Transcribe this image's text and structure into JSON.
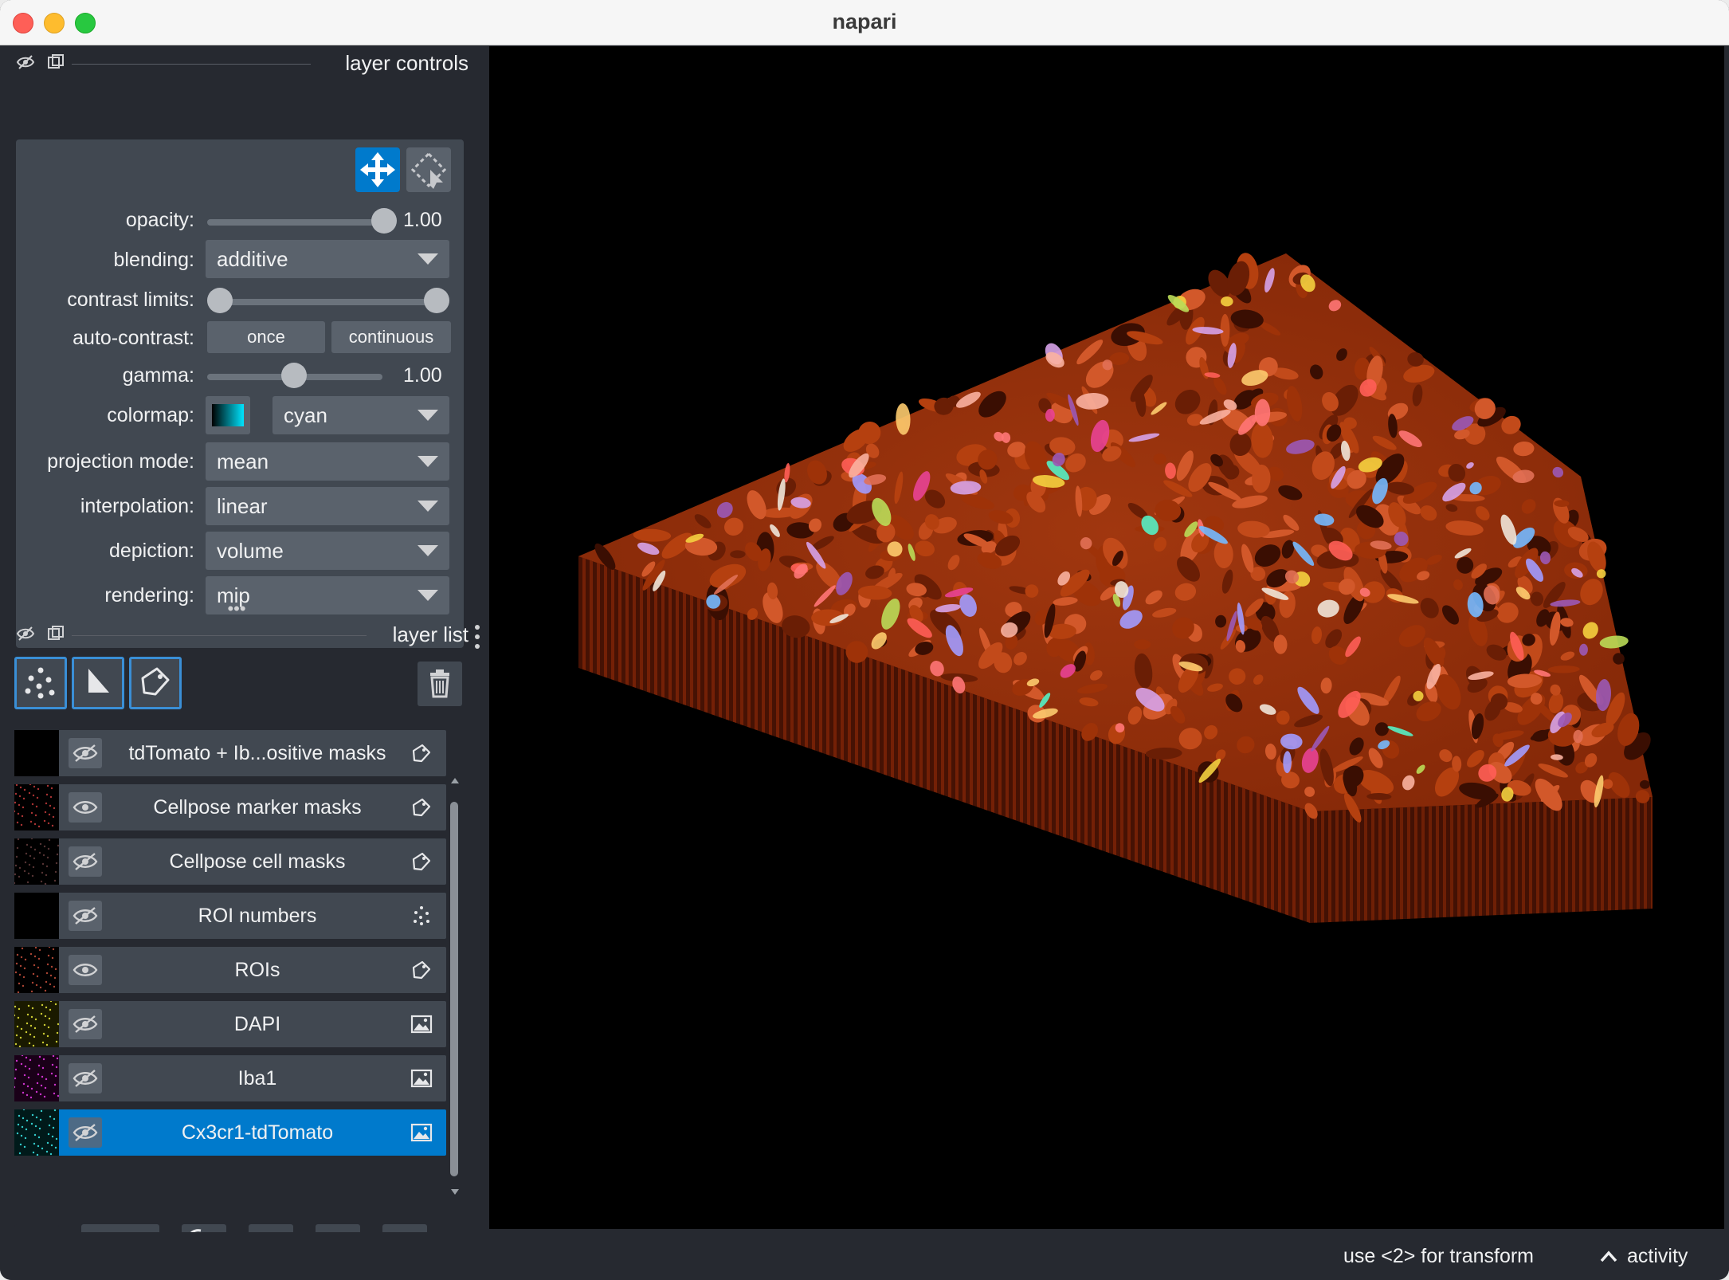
{
  "window": {
    "title": "napari"
  },
  "layer_controls": {
    "header": "layer controls",
    "opacity": {
      "label": "opacity:",
      "value": "1.00",
      "fraction": 1.0
    },
    "blending": {
      "label": "blending:",
      "value": "additive"
    },
    "contrast_limits": {
      "label": "contrast limits:",
      "range": [
        0.0,
        1.0
      ]
    },
    "auto_contrast": {
      "label": "auto-contrast:",
      "once": "once",
      "continuous": "continuous"
    },
    "gamma": {
      "label": "gamma:",
      "value": "1.00",
      "fraction": 0.45
    },
    "colormap": {
      "label": "colormap:",
      "value": "cyan"
    },
    "projection_mode": {
      "label": "projection mode:",
      "value": "mean"
    },
    "interpolation": {
      "label": "interpolation:",
      "value": "linear"
    },
    "depiction": {
      "label": "depiction:",
      "value": "volume"
    },
    "rendering": {
      "label": "rendering:",
      "value": "mip"
    }
  },
  "layer_list": {
    "header": "layer list",
    "layers": [
      {
        "name": "tdTomato + Ib...ositive masks",
        "type": "labels-icon",
        "visible": false,
        "selected": false
      },
      {
        "name": "Cellpose marker masks",
        "type": "labels-icon",
        "visible": true,
        "selected": false
      },
      {
        "name": "Cellpose cell masks",
        "type": "labels-icon",
        "visible": false,
        "selected": false
      },
      {
        "name": "ROI numbers",
        "type": "points-icon",
        "visible": false,
        "selected": false
      },
      {
        "name": "ROIs",
        "type": "labels-icon",
        "visible": true,
        "selected": false
      },
      {
        "name": "DAPI",
        "type": "image-icon",
        "visible": false,
        "selected": false
      },
      {
        "name": "Iba1",
        "type": "image-icon",
        "visible": false,
        "selected": false
      },
      {
        "name": "Cx3cr1-tdTomato",
        "type": "image-icon",
        "visible": false,
        "selected": true
      }
    ]
  },
  "status": {
    "hint": "use <2> for transform",
    "activity": "activity"
  },
  "colors": {
    "accent": "#007acc",
    "panel": "#262930",
    "control_bg": "#414851"
  }
}
